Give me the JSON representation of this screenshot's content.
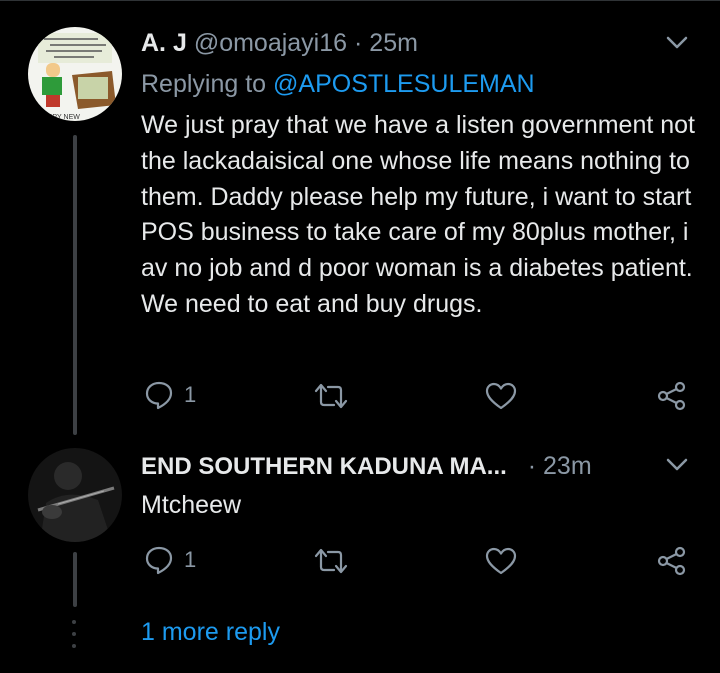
{
  "tweets": [
    {
      "name": "A. J",
      "handle": "@omoajayi16",
      "separator": "·",
      "time": "25m",
      "replying_prefix": "Replying to",
      "replying_to": "@APOSTLESULEMAN",
      "body": "We just pray that we have a listen government not the lackadaisical one whose life means nothing to them. Daddy please help my future, i want to start POS business to take care of my 80plus mother, i av no job and d poor woman is a diabetes patient. We need to eat and buy drugs.",
      "reply_count": "1",
      "avatar_text": "HAPPY NEW"
    },
    {
      "name": "END SOUTHERN KADUNA MA...",
      "separator": "·",
      "time": "23m",
      "body": "Mtcheew",
      "reply_count": "1"
    }
  ],
  "more_replies": "1 more reply",
  "colors": {
    "background": "#000000",
    "primary_text": "#e7e9ea",
    "secondary_text": "#8b98a5",
    "link": "#1d9bf0",
    "thread_line": "#3d4044"
  },
  "icons": [
    "reply-icon",
    "retweet-icon",
    "like-icon",
    "share-icon",
    "chevron-down-icon"
  ]
}
